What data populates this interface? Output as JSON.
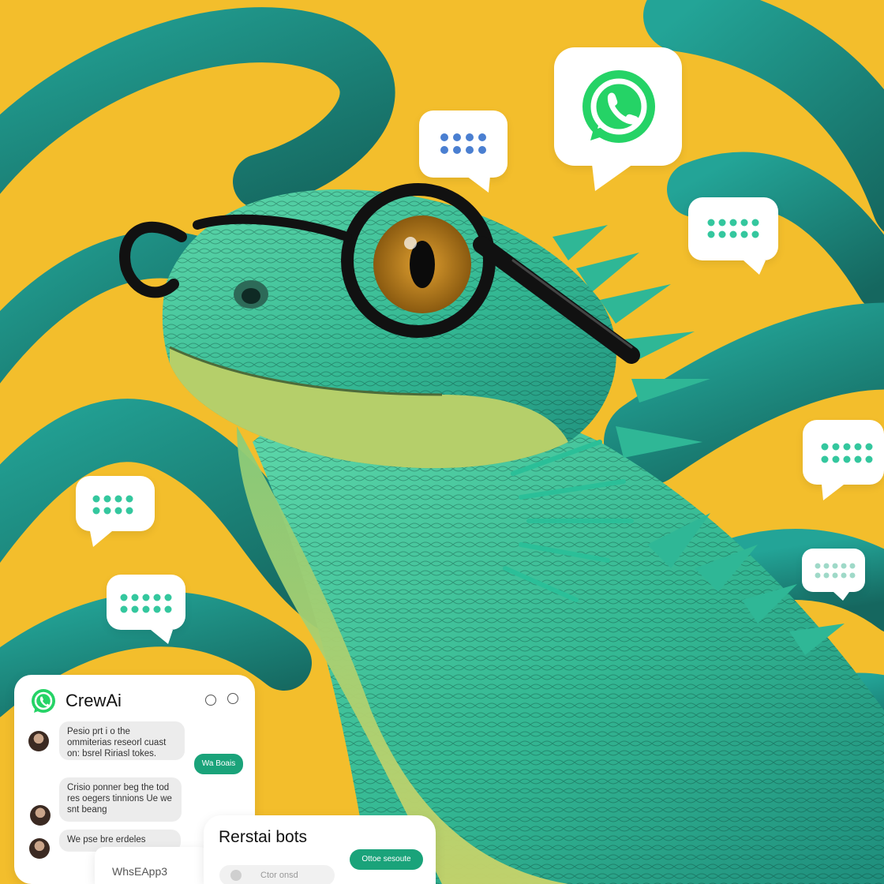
{
  "colors": {
    "background_yellow": "#F3BE2C",
    "swirl_teal": "#1E8F86",
    "lizard_green": "#3FC39C",
    "lizard_belly": "#B6D070",
    "glasses": "#111111",
    "eye_iris": "#C8841A",
    "dots_blue": "#4A7FD1",
    "dots_teal": "#34C79E",
    "whatsapp_green": "#25D366",
    "pill_green": "#1AA37A"
  },
  "icons": {
    "whatsapp_logo": "whatsapp-icon",
    "typing_dots": "typing-dots-icon",
    "avatar": "avatar-icon",
    "header_controls": "circle-control-icon"
  },
  "chat_panel": {
    "app_name": "CrewAi",
    "messages": [
      {
        "text": "Pesio prt i o the ommiterias reseorl cuast on: bsrel Ririasl tokes.",
        "side": "left"
      },
      {
        "text": "Wa Boais",
        "side": "right"
      },
      {
        "text": "Crisio ponner beg the tod res oegers tinnions Ue we snt beang",
        "side": "left"
      },
      {
        "text": "We pse bre erdeles",
        "side": "left"
      }
    ],
    "footer_label": "WhsEApp3"
  },
  "bots_panel": {
    "title": "Rerstai bots",
    "button_label": "Ottoe sesoute",
    "input_placeholder": "Ctor onsd"
  }
}
